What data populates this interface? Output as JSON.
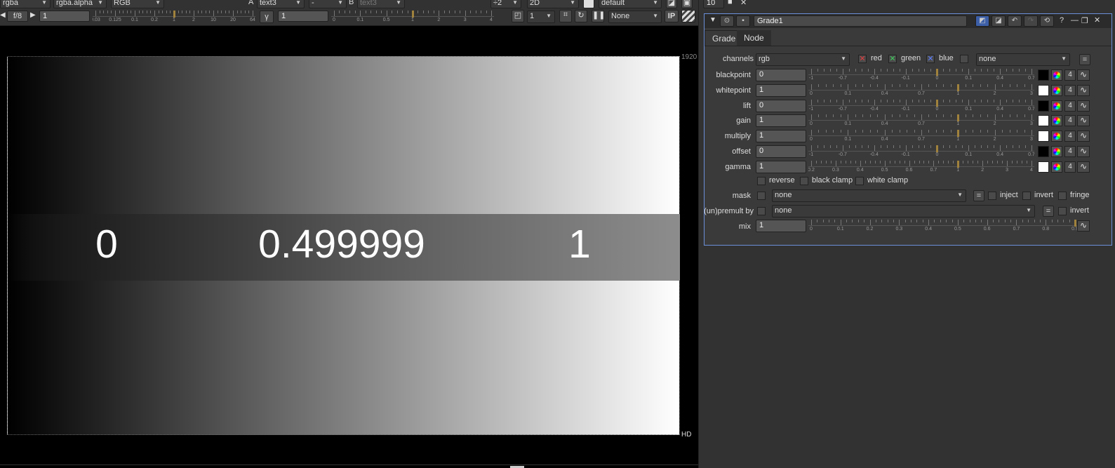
{
  "viewer": {
    "channels": "rgba",
    "alpha": "rgba.alpha",
    "colorspace": "RGB",
    "a_label": "A",
    "a_input": "text3",
    "comp_op": "-",
    "b_label": "B",
    "b_input": "text3",
    "downrez": "÷2",
    "view_mode": "2D",
    "lut": "default",
    "fstop": "f/8",
    "gain_value": "1",
    "gamma_label": "γ",
    "gamma_value": "1",
    "proxy_value": "1",
    "roi_mode": "None",
    "ip_label": "IP",
    "gain_scale": [
      "0.03",
      "0.125",
      "0.1",
      "0.2",
      "1",
      "2",
      "10",
      "20",
      "64"
    ],
    "gamma_scale": [
      "0",
      "0.1",
      "0.5",
      "1",
      "2",
      "3",
      "4"
    ],
    "format_top": "1920",
    "format_bottom": "HD",
    "big_numbers": [
      "0",
      "0.499999",
      "1"
    ],
    "top_field": "10"
  },
  "node": {
    "name": "Grade1",
    "tabs": [
      "Grade",
      "Node"
    ],
    "channels_label": "channels",
    "channels_value": "rgb",
    "chan_red": "red",
    "chan_green": "green",
    "chan_blue": "blue",
    "chan_extra": "none",
    "eq_label": "=",
    "params": [
      {
        "label": "blackpoint",
        "value": "0",
        "swatch": "#000000",
        "num": "4"
      },
      {
        "label": "whitepoint",
        "value": "1",
        "swatch": "#ffffff",
        "num": "4"
      },
      {
        "label": "lift",
        "value": "0",
        "swatch": "#000000",
        "num": "4"
      },
      {
        "label": "gain",
        "value": "1",
        "swatch": "#ffffff",
        "num": "4"
      },
      {
        "label": "multiply",
        "value": "1",
        "swatch": "#ffffff",
        "num": "4"
      },
      {
        "label": "offset",
        "value": "0",
        "swatch": "#000000",
        "num": "4"
      },
      {
        "label": "gamma",
        "value": "1",
        "swatch": "#ffffff",
        "num": "4"
      }
    ],
    "scale_a": [
      "-1",
      "-0.7",
      "-0.4",
      "-0.1",
      "0",
      "0.1",
      "0.4",
      "0.7"
    ],
    "scale_b": [
      "0",
      "0.1",
      "0.4",
      "0.7",
      "1",
      "2",
      "3"
    ],
    "scale_gamma": [
      "0.2",
      "0.3",
      "0.4",
      "0.5",
      "0.6",
      "0.7",
      "1",
      "2",
      "3",
      "4"
    ],
    "scale_mix": [
      "0",
      "0.1",
      "0.2",
      "0.3",
      "0.4",
      "0.5",
      "0.6",
      "0.7",
      "0.8",
      "0.9"
    ],
    "reverse": "reverse",
    "black_clamp": "black clamp",
    "white_clamp": "white clamp",
    "mask_label": "mask",
    "mask_value": "none",
    "inject": "inject",
    "invert": "invert",
    "fringe": "fringe",
    "premult_label": "(un)premult by",
    "premult_value": "none",
    "premult_invert": "invert",
    "mix_label": "mix",
    "mix_value": "1",
    "mix_fraction": 1.0
  },
  "colors": {
    "accent": "#6b8fd8",
    "handle": "#a0823c"
  }
}
